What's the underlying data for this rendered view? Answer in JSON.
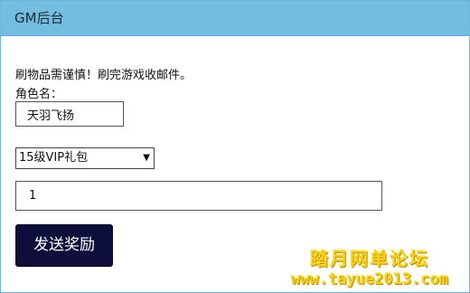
{
  "header": {
    "title": "GM后台"
  },
  "form": {
    "notice": "刷物品需谨慎！刷完游戏收邮件。",
    "role_label": "角色名：",
    "role_value": "天羽飞扬",
    "gift_select": {
      "selected": "15级VIP礼包"
    },
    "quantity_value": "1",
    "send_label": "发送奖励"
  },
  "watermark": {
    "title": "踏月网单论坛",
    "url": "www.tayue2013.com"
  },
  "colors": {
    "header_bg": "#72bde0",
    "button_bg": "#0d0f3a",
    "watermark": "#f5d219"
  }
}
